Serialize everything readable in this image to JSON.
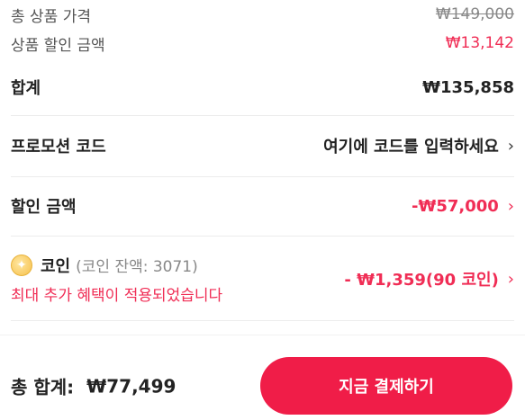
{
  "summary": {
    "original_price_label": "총 상품 가격",
    "original_price_value": "₩149,000",
    "product_discount_label": "상품 할인 금액",
    "product_discount_value": "₩13,142",
    "subtotal_label": "합계",
    "subtotal_value": "₩135,858"
  },
  "promo": {
    "label": "프로모션 코드",
    "placeholder": "여기에 코드를 입력하세요",
    "chevron": "›"
  },
  "discount": {
    "label": "할인 금액",
    "value": "-₩57,000",
    "chevron": "›"
  },
  "coin": {
    "icon": "coin-icon",
    "label": "코인",
    "balance": "(코인 잔액: 3071)",
    "note": "최대 추가 혜택이 적용되었습니다",
    "value": "- ₩1,359(90 코인)",
    "chevron": "›"
  },
  "footer": {
    "total_label": "총 합계:",
    "total_value": "₩77,499",
    "pay_button": "지금 결제하기"
  },
  "colors": {
    "accent": "#f01d48",
    "discount_text": "#f02d55"
  }
}
